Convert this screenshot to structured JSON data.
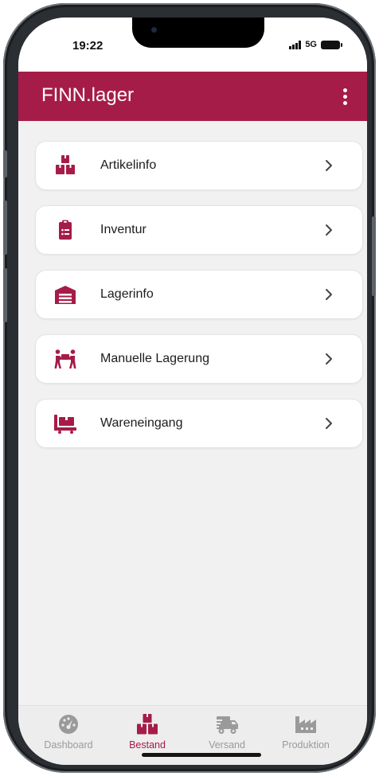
{
  "status_bar": {
    "time": "19:22",
    "network": "5G"
  },
  "app_bar": {
    "title": "FINN.lager"
  },
  "menu": [
    {
      "label": "Artikelinfo",
      "icon": "boxes-icon"
    },
    {
      "label": "Inventur",
      "icon": "clipboard-list-icon"
    },
    {
      "label": "Lagerinfo",
      "icon": "warehouse-icon"
    },
    {
      "label": "Manuelle Lagerung",
      "icon": "people-carry-box-icon"
    },
    {
      "label": "Wareneingang",
      "icon": "dolly-flatbed-icon"
    }
  ],
  "bottom_nav": [
    {
      "label": "Dashboard",
      "icon": "gauge-icon",
      "active": false
    },
    {
      "label": "Bestand",
      "icon": "boxes-icon",
      "active": true
    },
    {
      "label": "Versand",
      "icon": "truck-icon",
      "active": false
    },
    {
      "label": "Produktion",
      "icon": "factory-icon",
      "active": false
    }
  ],
  "colors": {
    "primary": "#a61c48",
    "background": "#f1f1f1",
    "card": "#ffffff",
    "nav_inactive": "#9a9a9a"
  }
}
